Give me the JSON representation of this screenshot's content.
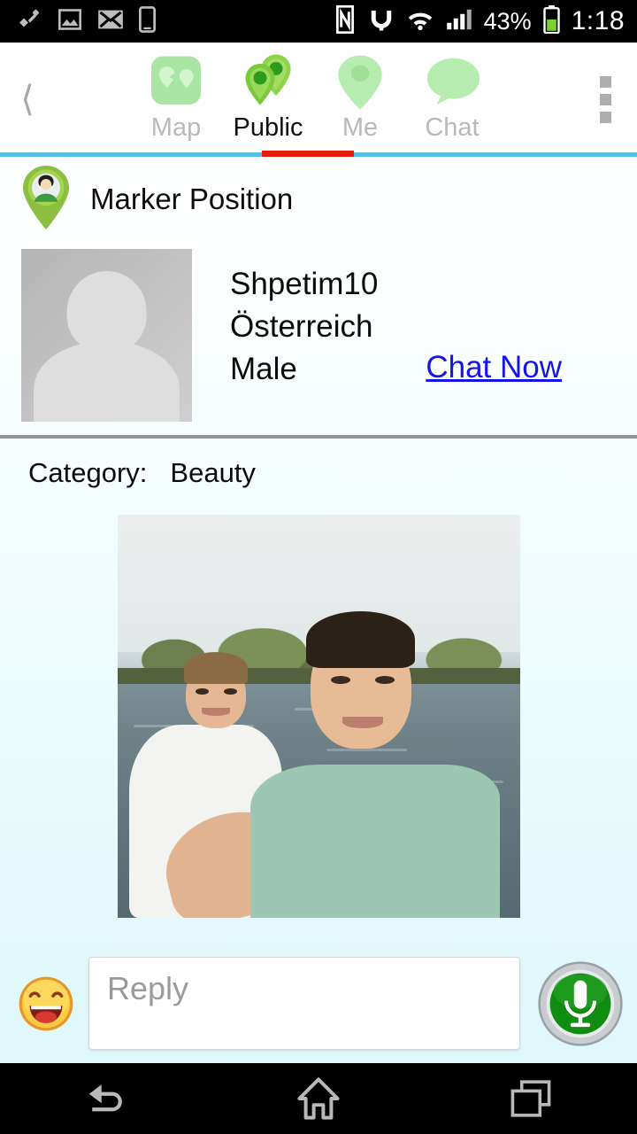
{
  "status_bar": {
    "icons_left": [
      "usb-plug-icon",
      "image-icon",
      "email-icon",
      "phone-icon"
    ],
    "icons_right": [
      "nfc-icon",
      "headset-icon",
      "wifi-icon",
      "signal-icon"
    ],
    "battery_percent": "43%",
    "time": "1:18"
  },
  "top_nav": {
    "back_icon": "back-chevron-icon",
    "overflow_icon": "overflow-menu-icon",
    "active_index": 1,
    "accent_line_color": "#56bde6",
    "active_indicator_color": "#e81b0d",
    "tabs": [
      {
        "label": "Map",
        "icon": "map-pins-square-icon",
        "active": false
      },
      {
        "label": "Public",
        "icon": "double-map-pin-icon",
        "active": true
      },
      {
        "label": "Me",
        "icon": "map-pin-icon",
        "active": false
      },
      {
        "label": "Chat",
        "icon": "speech-bubble-icon",
        "active": false
      }
    ]
  },
  "marker": {
    "icon": "map-pin-avatar-icon",
    "title": "Marker Position"
  },
  "profile": {
    "avatar_icon": "default-avatar-placeholder",
    "username": "Shpetim10",
    "country": "Österreich",
    "gender": "Male",
    "chat_link": "Chat Now",
    "chat_link_color": "#1614e8"
  },
  "post": {
    "category_label": "Category:",
    "category_value": "Beauty",
    "photo_alt": "Two young men posing for a selfie by a river with trees and boats in the background"
  },
  "reply_bar": {
    "emoji_icon": "laughing-emoji-icon",
    "input_value": "",
    "input_placeholder": "Reply",
    "mic_icon": "microphone-button-icon"
  },
  "system_nav": {
    "back": "back-nav-icon",
    "home": "home-nav-icon",
    "recents": "recents-nav-icon"
  }
}
